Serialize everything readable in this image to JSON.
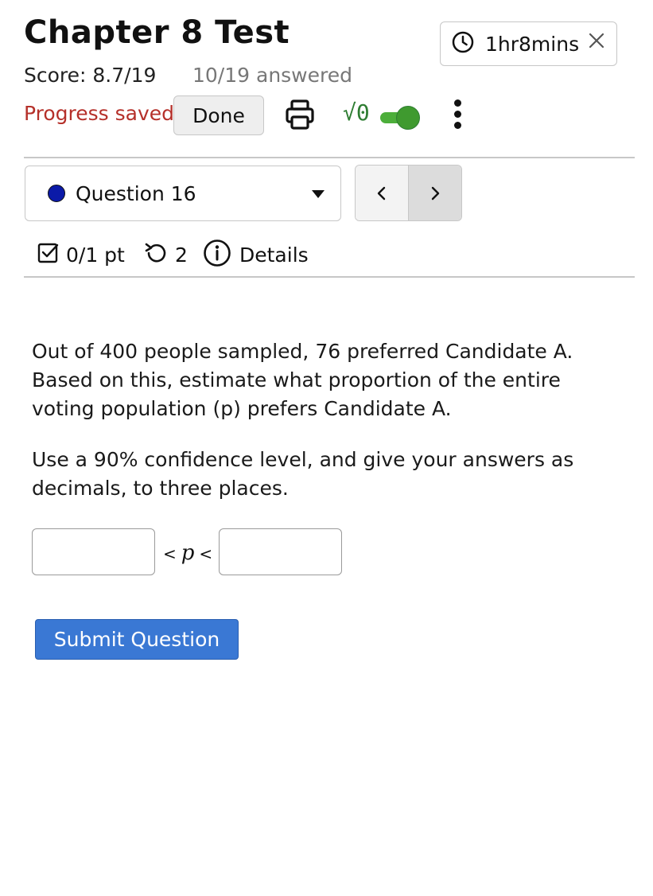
{
  "header": {
    "title": "Chapter 8 Test",
    "score": "Score: 8.7/19",
    "answered": "10/19 answered",
    "timer": {
      "icon": "clock-icon",
      "text": "1hr8mins",
      "close_icon": "close-icon"
    }
  },
  "toolbar": {
    "progress_status": "Progress saved",
    "done_label": "Done",
    "print_icon": "printer-icon",
    "math_icon_text": "√0",
    "math_toggle_on": true,
    "more_icon": "more-vertical-icon",
    "colors": {
      "progress": "#b5302a",
      "toggle": "#4cae3a",
      "math": "#2e7d32"
    }
  },
  "question_nav": {
    "selected_label": "Question 16",
    "status_color": "#0b1aa8",
    "prev_icon": "chevron-left-icon",
    "next_icon": "chevron-right-icon"
  },
  "question_meta": {
    "points": "0/1 pt",
    "retries": "2",
    "details_label": "Details"
  },
  "question": {
    "paragraph1": "Out of 400 people sampled, 76 preferred Candidate A. Based on this, estimate what proportion of the entire voting population (p) prefers Candidate A.",
    "paragraph2": "Use a 90% confidence level, and give your answers as decimals, to three places.",
    "inequality": {
      "lt1": "<",
      "var": "p",
      "lt2": "<"
    },
    "lower_value": "",
    "upper_value": ""
  },
  "submit": {
    "label": "Submit Question",
    "color": "#3a78d4"
  }
}
